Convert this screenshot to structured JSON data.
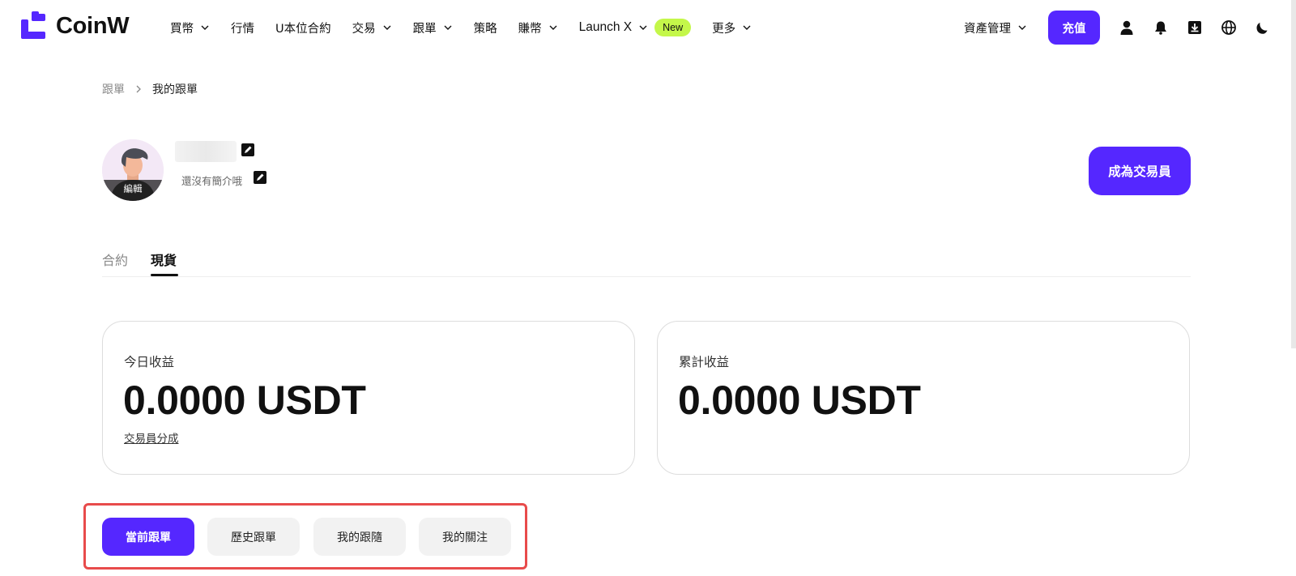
{
  "brand": {
    "name": "CoinW",
    "accent": "#5527ff",
    "badge_color": "#c4f74a",
    "highlight_color": "#e84b4b"
  },
  "nav": {
    "items": [
      {
        "label": "買幣",
        "dropdown": true
      },
      {
        "label": "行情",
        "dropdown": false
      },
      {
        "label": "U本位合約",
        "dropdown": false
      },
      {
        "label": "交易",
        "dropdown": true
      },
      {
        "label": "跟單",
        "dropdown": true
      },
      {
        "label": "策略",
        "dropdown": false
      },
      {
        "label": "賺幣",
        "dropdown": true
      },
      {
        "label": "Launch X",
        "dropdown": true,
        "badge": "New"
      },
      {
        "label": "更多",
        "dropdown": true
      }
    ],
    "asset_management": "資產管理",
    "deposit": "充值",
    "icons": [
      "user-icon",
      "bell-icon",
      "download-icon",
      "globe-icon",
      "moon-icon"
    ]
  },
  "breadcrumb": {
    "parent": "跟單",
    "current": "我的跟單"
  },
  "profile": {
    "avatar_edit": "編輯",
    "bio": "還沒有簡介哦",
    "become_trader": "成為交易員"
  },
  "tabs": {
    "contract": "合約",
    "spot": "現貨",
    "active": "spot"
  },
  "cards": {
    "today": {
      "label": "今日收益",
      "value": "0.0000 USDT",
      "link": "交易員分成"
    },
    "total": {
      "label": "累計收益",
      "value": "0.0000 USDT"
    }
  },
  "subtabs": {
    "current": "當前跟單",
    "history": "歷史跟單",
    "my_follows": "我的跟隨",
    "my_watchlist": "我的關注",
    "active": "current"
  }
}
